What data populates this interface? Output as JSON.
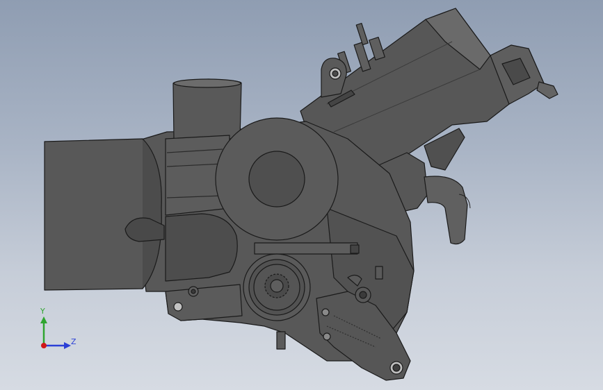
{
  "viewport": {
    "background_top": "#8f9db2",
    "background_bottom": "#d6dbe3",
    "model_fill": "#525252",
    "model_edge": "#1a1a1a"
  },
  "triad": {
    "y_label": "Y",
    "z_label": "Z",
    "y_color": "#2fa52f",
    "z_color": "#2b3fd6",
    "origin_color": "#d01818"
  }
}
